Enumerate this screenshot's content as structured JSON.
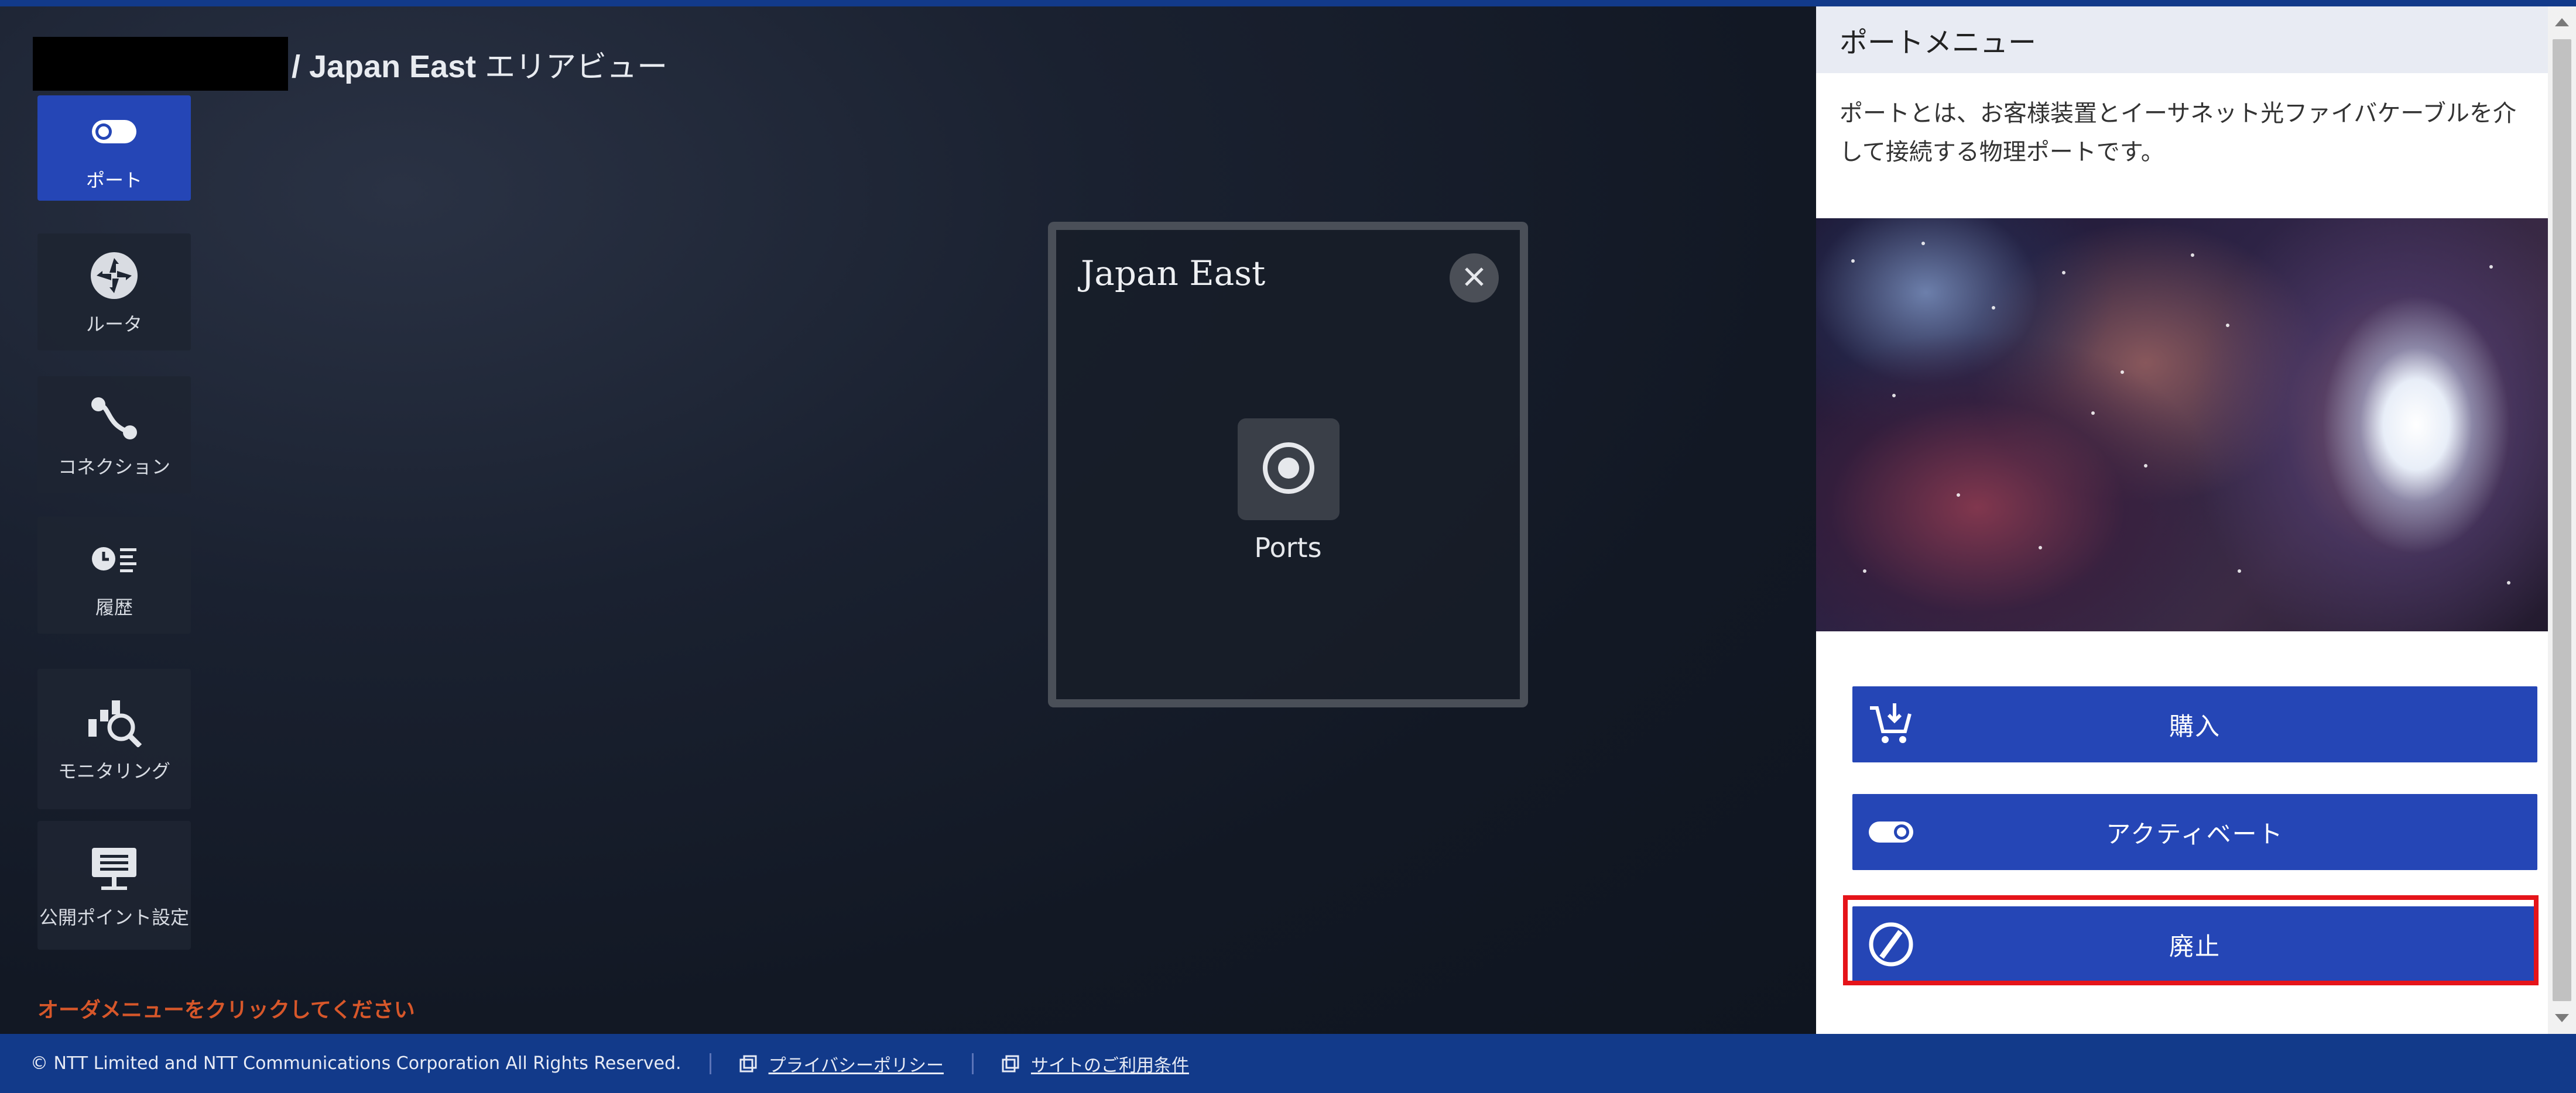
{
  "header": {
    "title": "/ Japan East",
    "title_suffix": "エリアビュー"
  },
  "sidebar": {
    "items": [
      {
        "label": "ポート",
        "icon": "port-toggle-icon",
        "active": true
      },
      {
        "label": "ルータ",
        "icon": "router-icon",
        "active": false
      },
      {
        "label": "コネクション",
        "icon": "connection-icon",
        "active": false
      },
      {
        "label": "履歴",
        "icon": "history-icon",
        "active": false
      },
      {
        "label": "モニタリング",
        "icon": "monitoring-icon",
        "active": false
      },
      {
        "label": "公開ポイント設定",
        "icon": "public-point-icon",
        "active": false
      }
    ],
    "hint": "オーダメニューをクリックしてください"
  },
  "dialog": {
    "title": "Japan East",
    "item_label": "Ports"
  },
  "panel": {
    "title": "ポートメニュー",
    "description": "ポートとは、お客様装置とイーサネット光ファイバケーブルを介して接続する物理ポートです。",
    "buttons": [
      {
        "label": "購入",
        "icon": "cart-download-icon"
      },
      {
        "label": "アクティベート",
        "icon": "toggle-on-icon"
      },
      {
        "label": "廃止",
        "icon": "prohibited-icon",
        "highlighted": true
      }
    ]
  },
  "footer": {
    "copyright": "© NTT Limited and NTT Communications Corporation All Rights Reserved.",
    "privacy": "プライバシーポリシー",
    "terms": "サイトのご利用条件"
  },
  "colors": {
    "accent": "#2546b6",
    "highlight": "#e5141a",
    "hint": "#d7572a",
    "footer": "#123a8a"
  }
}
